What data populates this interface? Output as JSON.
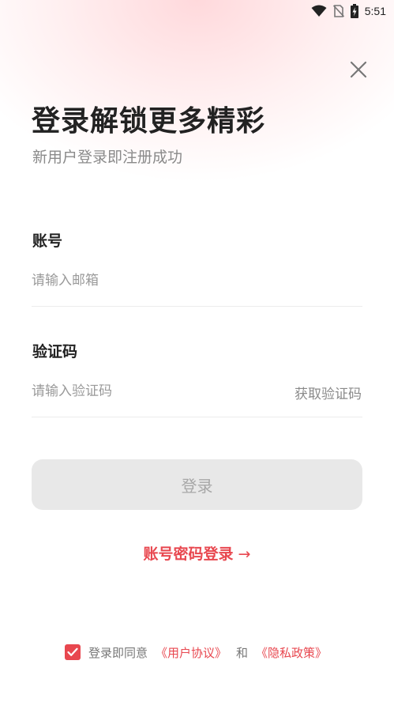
{
  "status_bar": {
    "time": "5:51"
  },
  "header": {
    "title": "登录解锁更多精彩",
    "subtitle": "新用户登录即注册成功"
  },
  "account": {
    "label": "账号",
    "placeholder": "请输入邮箱",
    "value": ""
  },
  "code": {
    "label": "验证码",
    "placeholder": "请输入验证码",
    "value": "",
    "get_code": "获取验证码"
  },
  "login_button": "登录",
  "password_login": {
    "label": "账号密码登录",
    "arrow": "→"
  },
  "agreement": {
    "checked": true,
    "prefix": "登录即同意",
    "user_agreement": "《用户协议》",
    "and": "和",
    "privacy_policy": "《隐私政策》"
  },
  "colors": {
    "accent": "#e8474f",
    "button_disabled_bg": "#e8e8e8",
    "button_disabled_text": "#a7a7a7"
  },
  "icons": [
    "wifi-icon",
    "no-sim-icon",
    "battery-charging-icon",
    "close-icon",
    "checkmark-icon",
    "arrow-right-icon"
  ]
}
